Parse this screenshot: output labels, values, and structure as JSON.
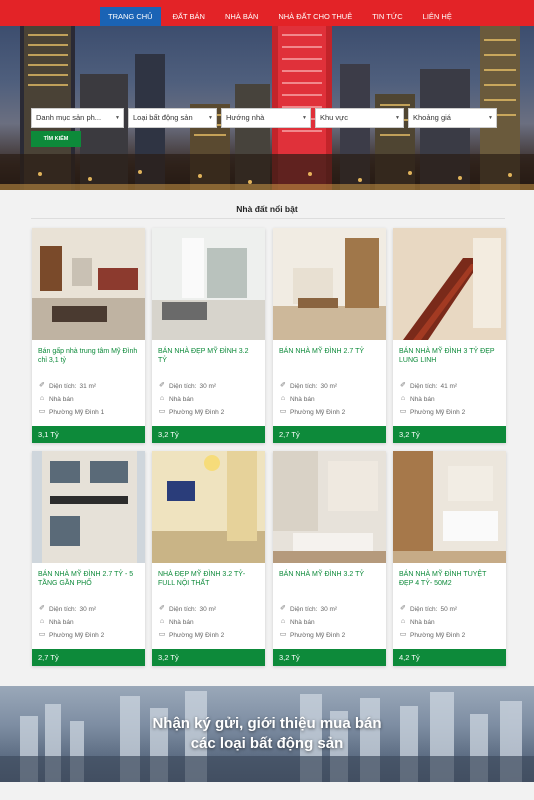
{
  "nav": {
    "items": [
      {
        "label": "TRANG CHỦ",
        "active": true
      },
      {
        "label": "ĐẤT BÁN",
        "active": false
      },
      {
        "label": "NHÀ BÁN",
        "active": false
      },
      {
        "label": "NHÀ ĐẤT CHO THUÊ",
        "active": false
      },
      {
        "label": "TIN TỨC",
        "active": false
      },
      {
        "label": "LIÊN HỆ",
        "active": false
      }
    ]
  },
  "search": {
    "filters": [
      "Danh mục sản ph...",
      "Loại bất động sản",
      "Hướng nhà",
      "Khu vực",
      "Khoảng giá"
    ],
    "button": "TÌM KIẾM"
  },
  "featured": {
    "title": "Nhà đất nổi bật",
    "area_label": "Diện tích:",
    "listings": [
      {
        "title": "Bán gấp nhà trung tâm Mỹ Đình chỉ 3,1 tỷ",
        "area": "31 m²",
        "type": "Nhà bán",
        "location": "Phường Mỹ Đình 1",
        "price": "3,1 Tỷ"
      },
      {
        "title": "BÁN NHÀ ĐẸP MỸ ĐÌNH 3.2 TỶ",
        "area": "30 m²",
        "type": "Nhà bán",
        "location": "Phường Mỹ Đình 2",
        "price": "3,2 Tỷ"
      },
      {
        "title": "BÁN NHÀ MỸ ĐÌNH 2.7 TỶ",
        "area": "30 m²",
        "type": "Nhà bán",
        "location": "Phường Mỹ Đình 2",
        "price": "2,7 Tỷ"
      },
      {
        "title": "BÁN NHÀ MỸ ĐÌNH 3 TỶ ĐẸP LUNG LINH",
        "area": "41 m²",
        "type": "Nhà bán",
        "location": "Phường Mỹ Đình 2",
        "price": "3,2 Tỷ"
      },
      {
        "title": "BÁN NHÀ MỸ ĐÌNH 2.7 TỶ - 5 TẦNG GẦN PHỐ",
        "area": "30 m²",
        "type": "Nhà bán",
        "location": "Phường Mỹ Đình 2",
        "price": "2,7 Tỷ"
      },
      {
        "title": "NHÀ ĐẸP MỸ ĐÌNH 3.2 TỶ- FULL NỘI THẤT",
        "area": "30 m²",
        "type": "Nhà bán",
        "location": "Phường Mỹ Đình 2",
        "price": "3,2 Tỷ"
      },
      {
        "title": "BÁN NHÀ MỸ ĐÌNH 3.2 TỶ",
        "area": "30 m²",
        "type": "Nhà bán",
        "location": "Phường Mỹ Đình 2",
        "price": "3,2 Tỷ"
      },
      {
        "title": "BÁN NHÀ MỸ ĐÌNH TUYỆT ĐẸP 4 TỶ- 50M2",
        "area": "50 m²",
        "type": "Nhà bán",
        "location": "Phường Mỹ Đình 2",
        "price": "4,2 Tỷ"
      }
    ]
  },
  "banner": {
    "line1": "Nhận ký gửi, giới thiệu mua bán",
    "line2": "các loại bất động sản"
  },
  "icons": {
    "area": "ruler-icon",
    "type": "home-icon",
    "location": "map-icon",
    "caret": "chevron-down-icon"
  },
  "colors": {
    "nav_bg": "#e32327",
    "nav_active": "#1a63b5",
    "accent_green": "#0d8a3a"
  }
}
